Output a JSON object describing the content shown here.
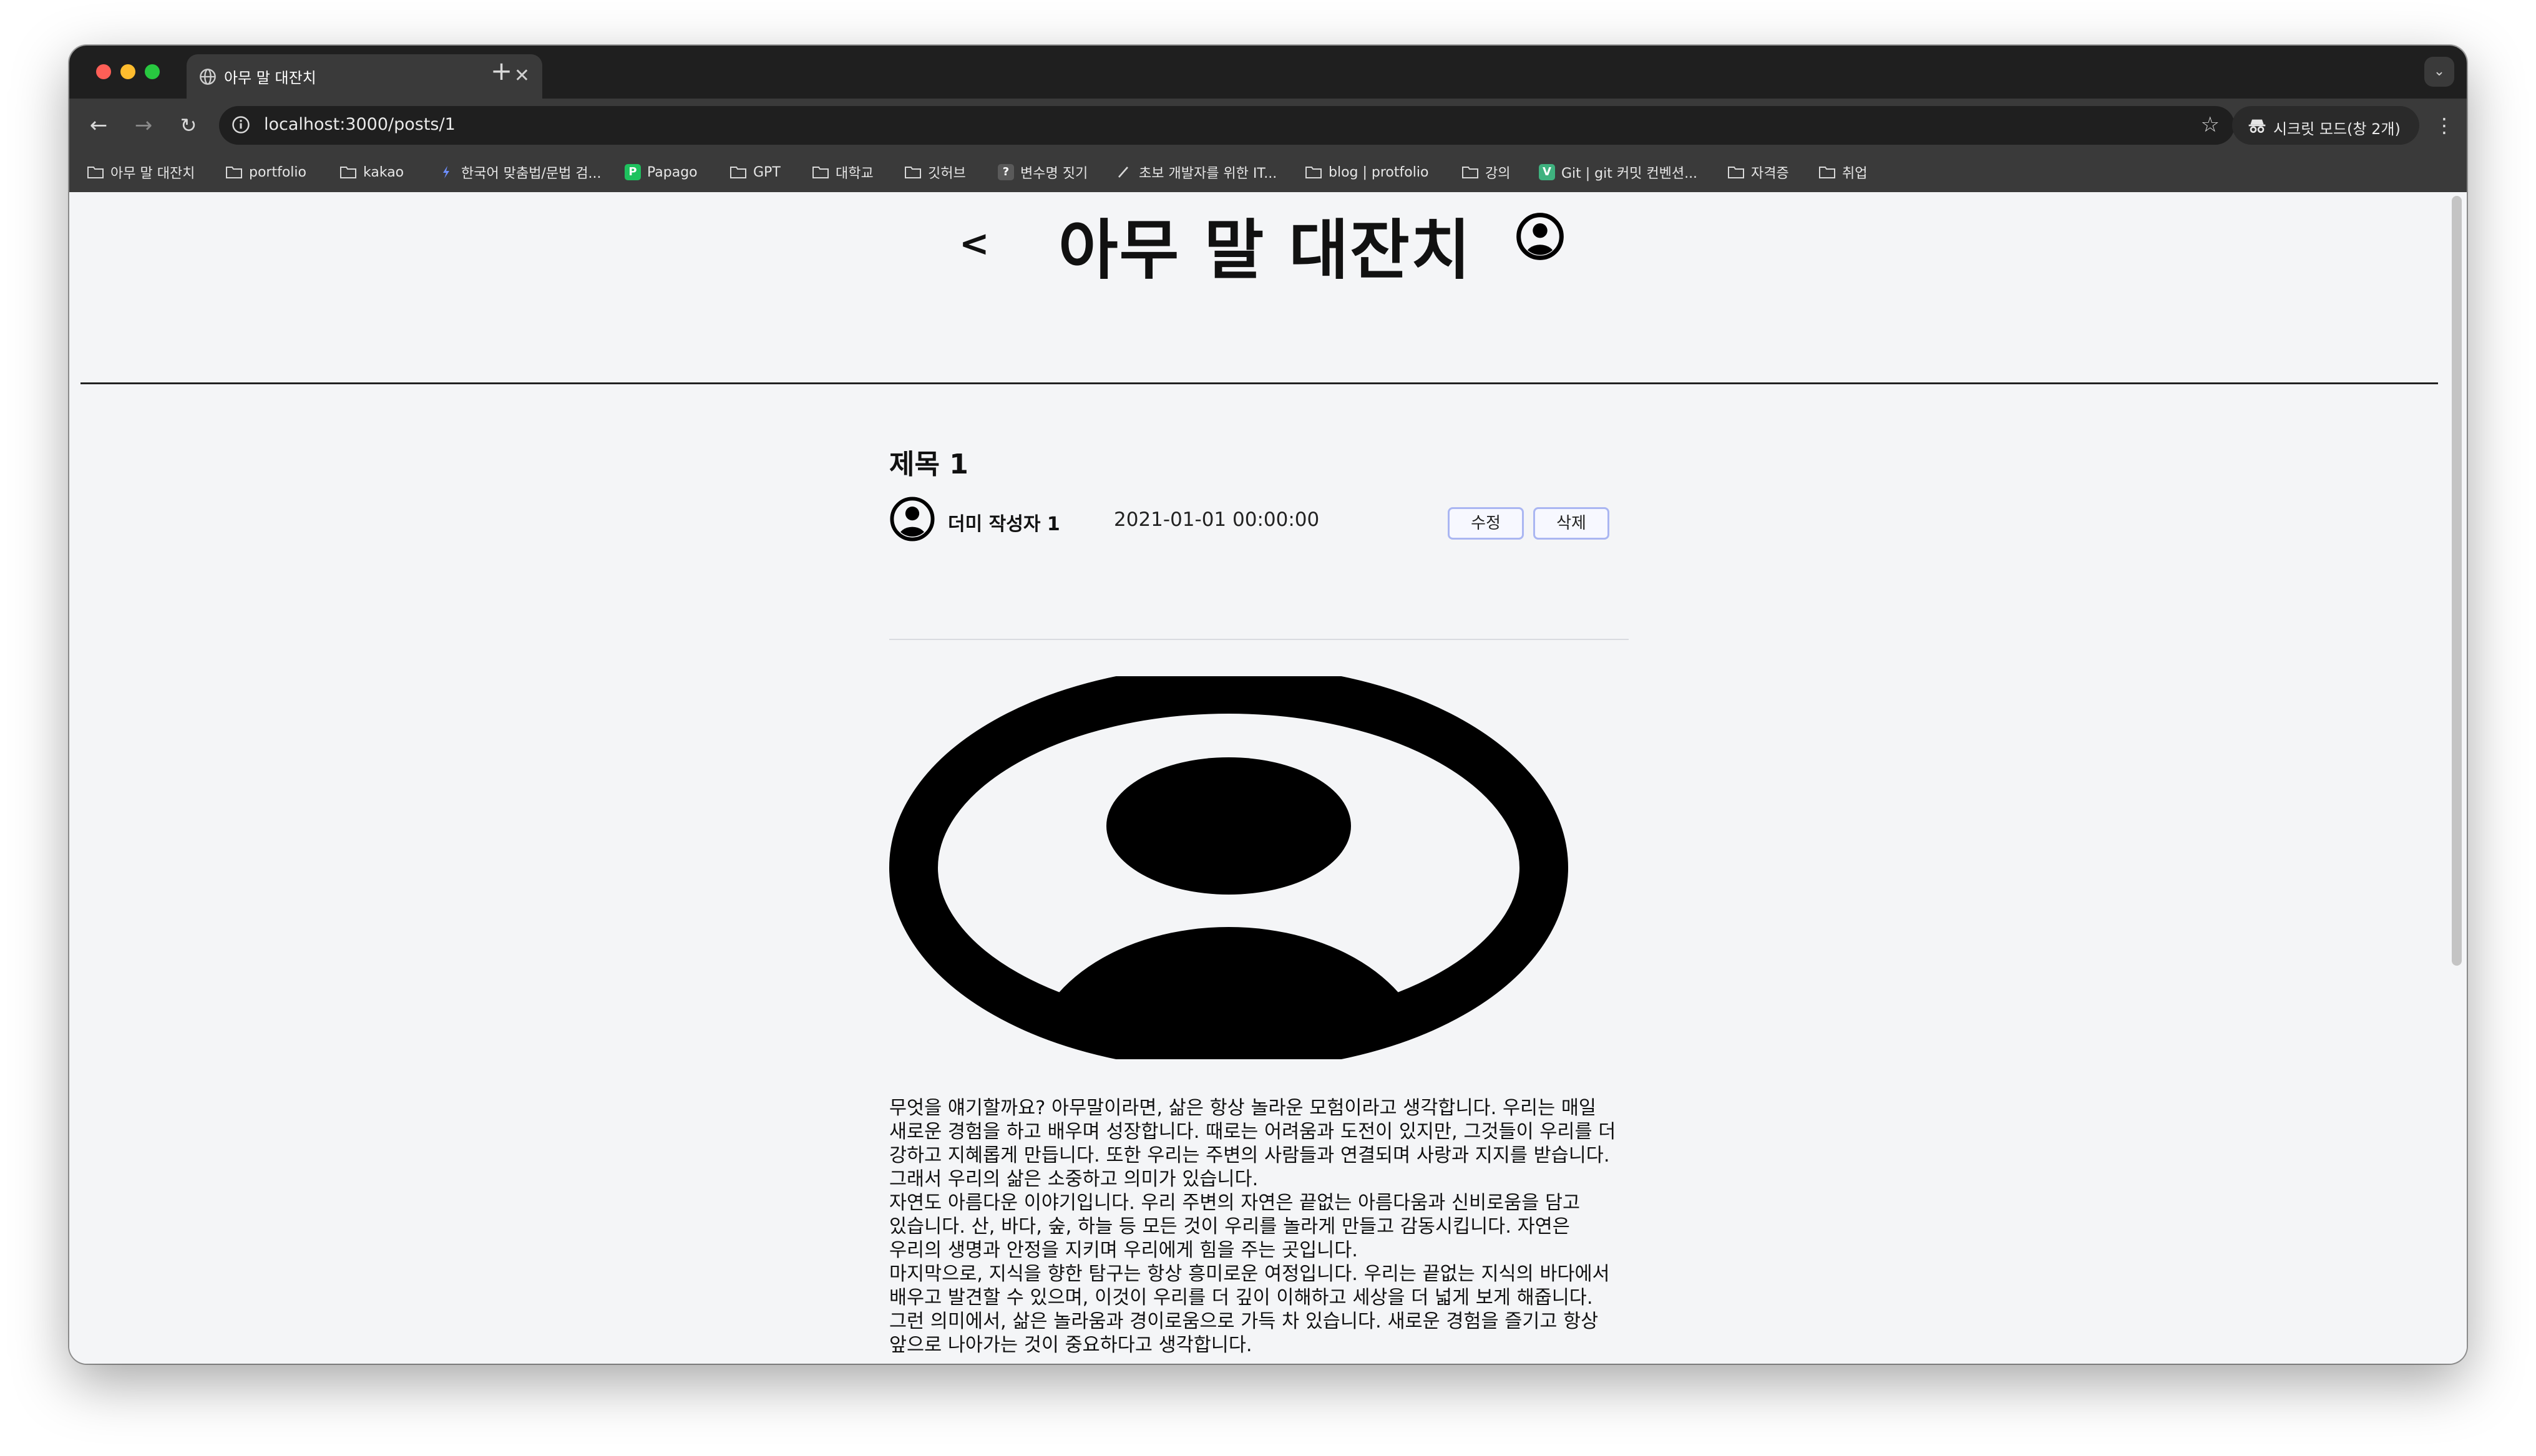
{
  "browser": {
    "tab_title": "아무 말 대잔치",
    "url": "localhost:3000/posts/1",
    "incognito_label": "시크릿 모드(창 2개)",
    "bookmarks": [
      {
        "label": "아무 말 대잔치",
        "icon": "folder-icon"
      },
      {
        "label": "portfolio",
        "icon": "folder-icon"
      },
      {
        "label": "kakao",
        "icon": "folder-icon"
      },
      {
        "label": "한국어 맞춤법/문법 검...",
        "icon": "spellcheck-icon"
      },
      {
        "label": "Papago",
        "icon": "papago-icon"
      },
      {
        "label": "GPT",
        "icon": "folder-icon"
      },
      {
        "label": "대학교",
        "icon": "folder-icon"
      },
      {
        "label": "깃허브",
        "icon": "folder-icon"
      },
      {
        "label": "변수명 짓기",
        "icon": "question-icon"
      },
      {
        "label": "초보 개발자를 위한 IT...",
        "icon": "link-icon"
      },
      {
        "label": "blog | protfolio",
        "icon": "folder-icon"
      },
      {
        "label": "강의",
        "icon": "folder-icon"
      },
      {
        "label": "Git | git 커밋 컨벤션...",
        "icon": "v-icon"
      },
      {
        "label": "자격증",
        "icon": "folder-icon"
      },
      {
        "label": "취업",
        "icon": "folder-icon"
      }
    ]
  },
  "header": {
    "back_label": "<",
    "site_title": "아무 말 대잔치",
    "avatar_icon": "user-circle-icon"
  },
  "post": {
    "title": "제목 1",
    "author": "더미 작성자 1",
    "date": "2021-01-01 00:00:00",
    "edit_label": "수정",
    "delete_label": "삭제",
    "image_icon": "user-circle-icon",
    "body": "무엇을 얘기할까요? 아무말이라면, 삶은 항상 놀라운 모험이라고 생각합니다. 우리는 매일 새로운 경험을 하고 배우며 성장합니다. 때로는 어려움과 도전이 있지만, 그것들이 우리를 더 강하고 지혜롭게 만듭니다. 또한 우리는 주변의 사람들과 연결되며 사랑과 지지를 받습니다. 그래서 우리의 삶은 소중하고 의미가 있습니다.\n자연도 아름다운 이야기입니다. 우리 주변의 자연은 끝없는 아름다움과 신비로움을 담고 있습니다. 산, 바다, 숲, 하늘 등 모든 것이 우리를 놀라게 만들고 감동시킵니다. 자연은 우리의 생명과 안정을 지키며 우리에게 힘을 주는 곳입니다.\n마지막으로, 지식을 향한 탐구는 항상 흥미로운 여정입니다. 우리는 끝없는 지식의 바다에서 배우고 발견할 수 있으며, 이것이 우리를 더 깊이 이해하고 세상을 더 넓게 보게 해줍니다.\n그런 의미에서, 삶은 놀라움과 경이로움으로 가득 차 있습니다. 새로운 경험을 즐기고 항상 앞으로 나아가는 것이 중요하다고 생각합니다."
  }
}
